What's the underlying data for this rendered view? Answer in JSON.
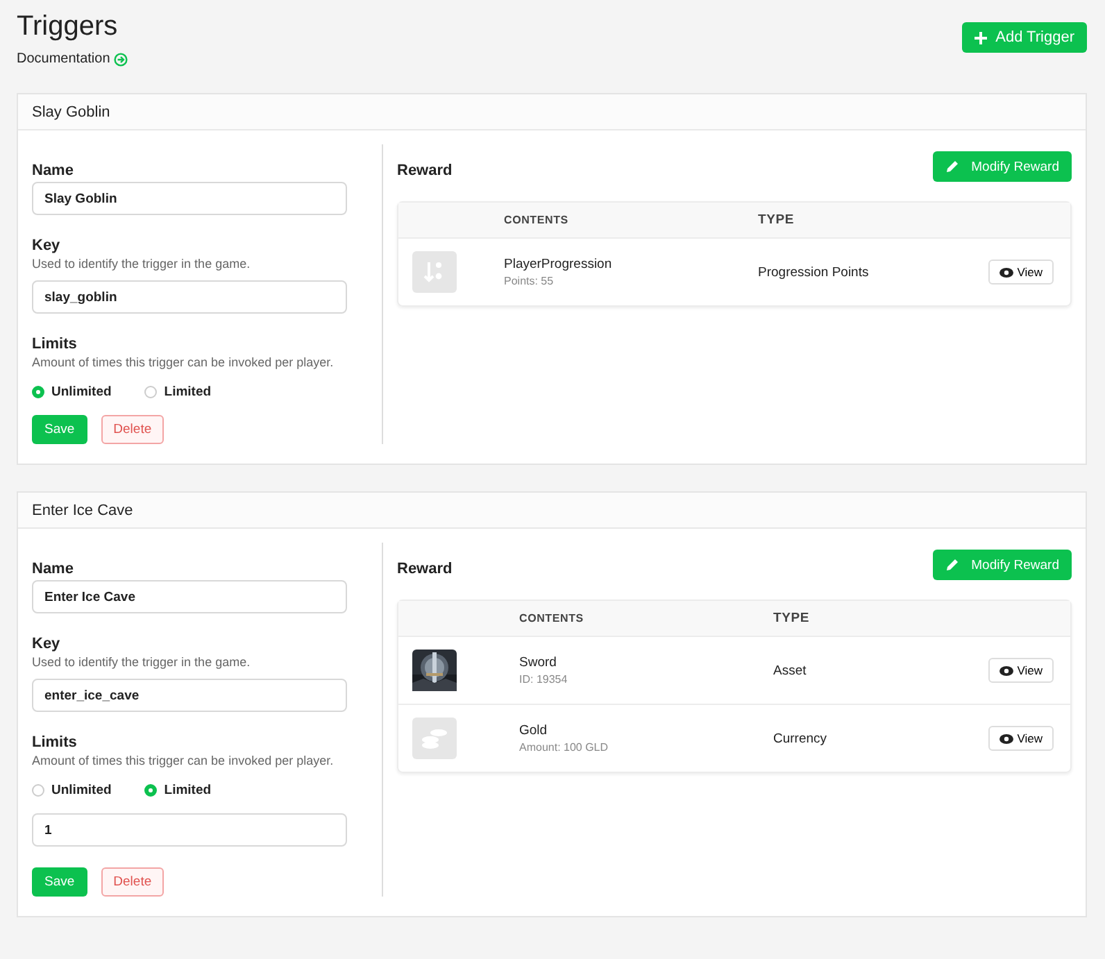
{
  "page": {
    "title": "Triggers",
    "doc_link": "Documentation",
    "add_button": "Add Trigger"
  },
  "triggers": [
    {
      "title": "Slay Goblin",
      "name_label": "Name",
      "name_value": "Slay Goblin",
      "key_label": "Key",
      "key_hint": "Used to identify the trigger in the game.",
      "key_value": "slay_goblin",
      "limits_label": "Limits",
      "limits_hint": "Amount of times this trigger can be invoked per player.",
      "options": [
        {
          "label": "Unlimited",
          "selected": true
        },
        {
          "label": "Limited",
          "selected": false
        }
      ],
      "save": "Save",
      "delete": "Delete",
      "reward_label": "Reward",
      "modify": "Modify Reward",
      "columns": [
        "CONTENTS",
        "TYPE"
      ],
      "rows": [
        {
          "kind": "progression",
          "name": "PlayerProgression",
          "detail": "Points: 55",
          "type": "Progression Points",
          "action": "View"
        }
      ]
    },
    {
      "title": "Enter Ice Cave",
      "name_label": "Name",
      "name_value": "Enter Ice Cave",
      "key_label": "Key",
      "key_hint": "Used to identify the trigger in the game.",
      "key_value": "enter_ice_cave",
      "limits_label": "Limits",
      "limits_hint": "Amount of times this trigger can be invoked per player.",
      "options": [
        {
          "label": "Unlimited",
          "selected": false
        },
        {
          "label": "Limited",
          "selected": true
        }
      ],
      "limit_value": "1",
      "save": "Save",
      "delete": "Delete",
      "reward_label": "Reward",
      "modify": "Modify Reward",
      "columns": [
        "CONTENTS",
        "TYPE"
      ],
      "rows": [
        {
          "kind": "picture",
          "name": "Sword",
          "detail": "ID: 19354",
          "type": "Asset",
          "action": "View"
        },
        {
          "kind": "currency",
          "name": "Gold",
          "detail": "Amount: 100 GLD",
          "type": "Currency",
          "action": "View"
        }
      ]
    }
  ]
}
